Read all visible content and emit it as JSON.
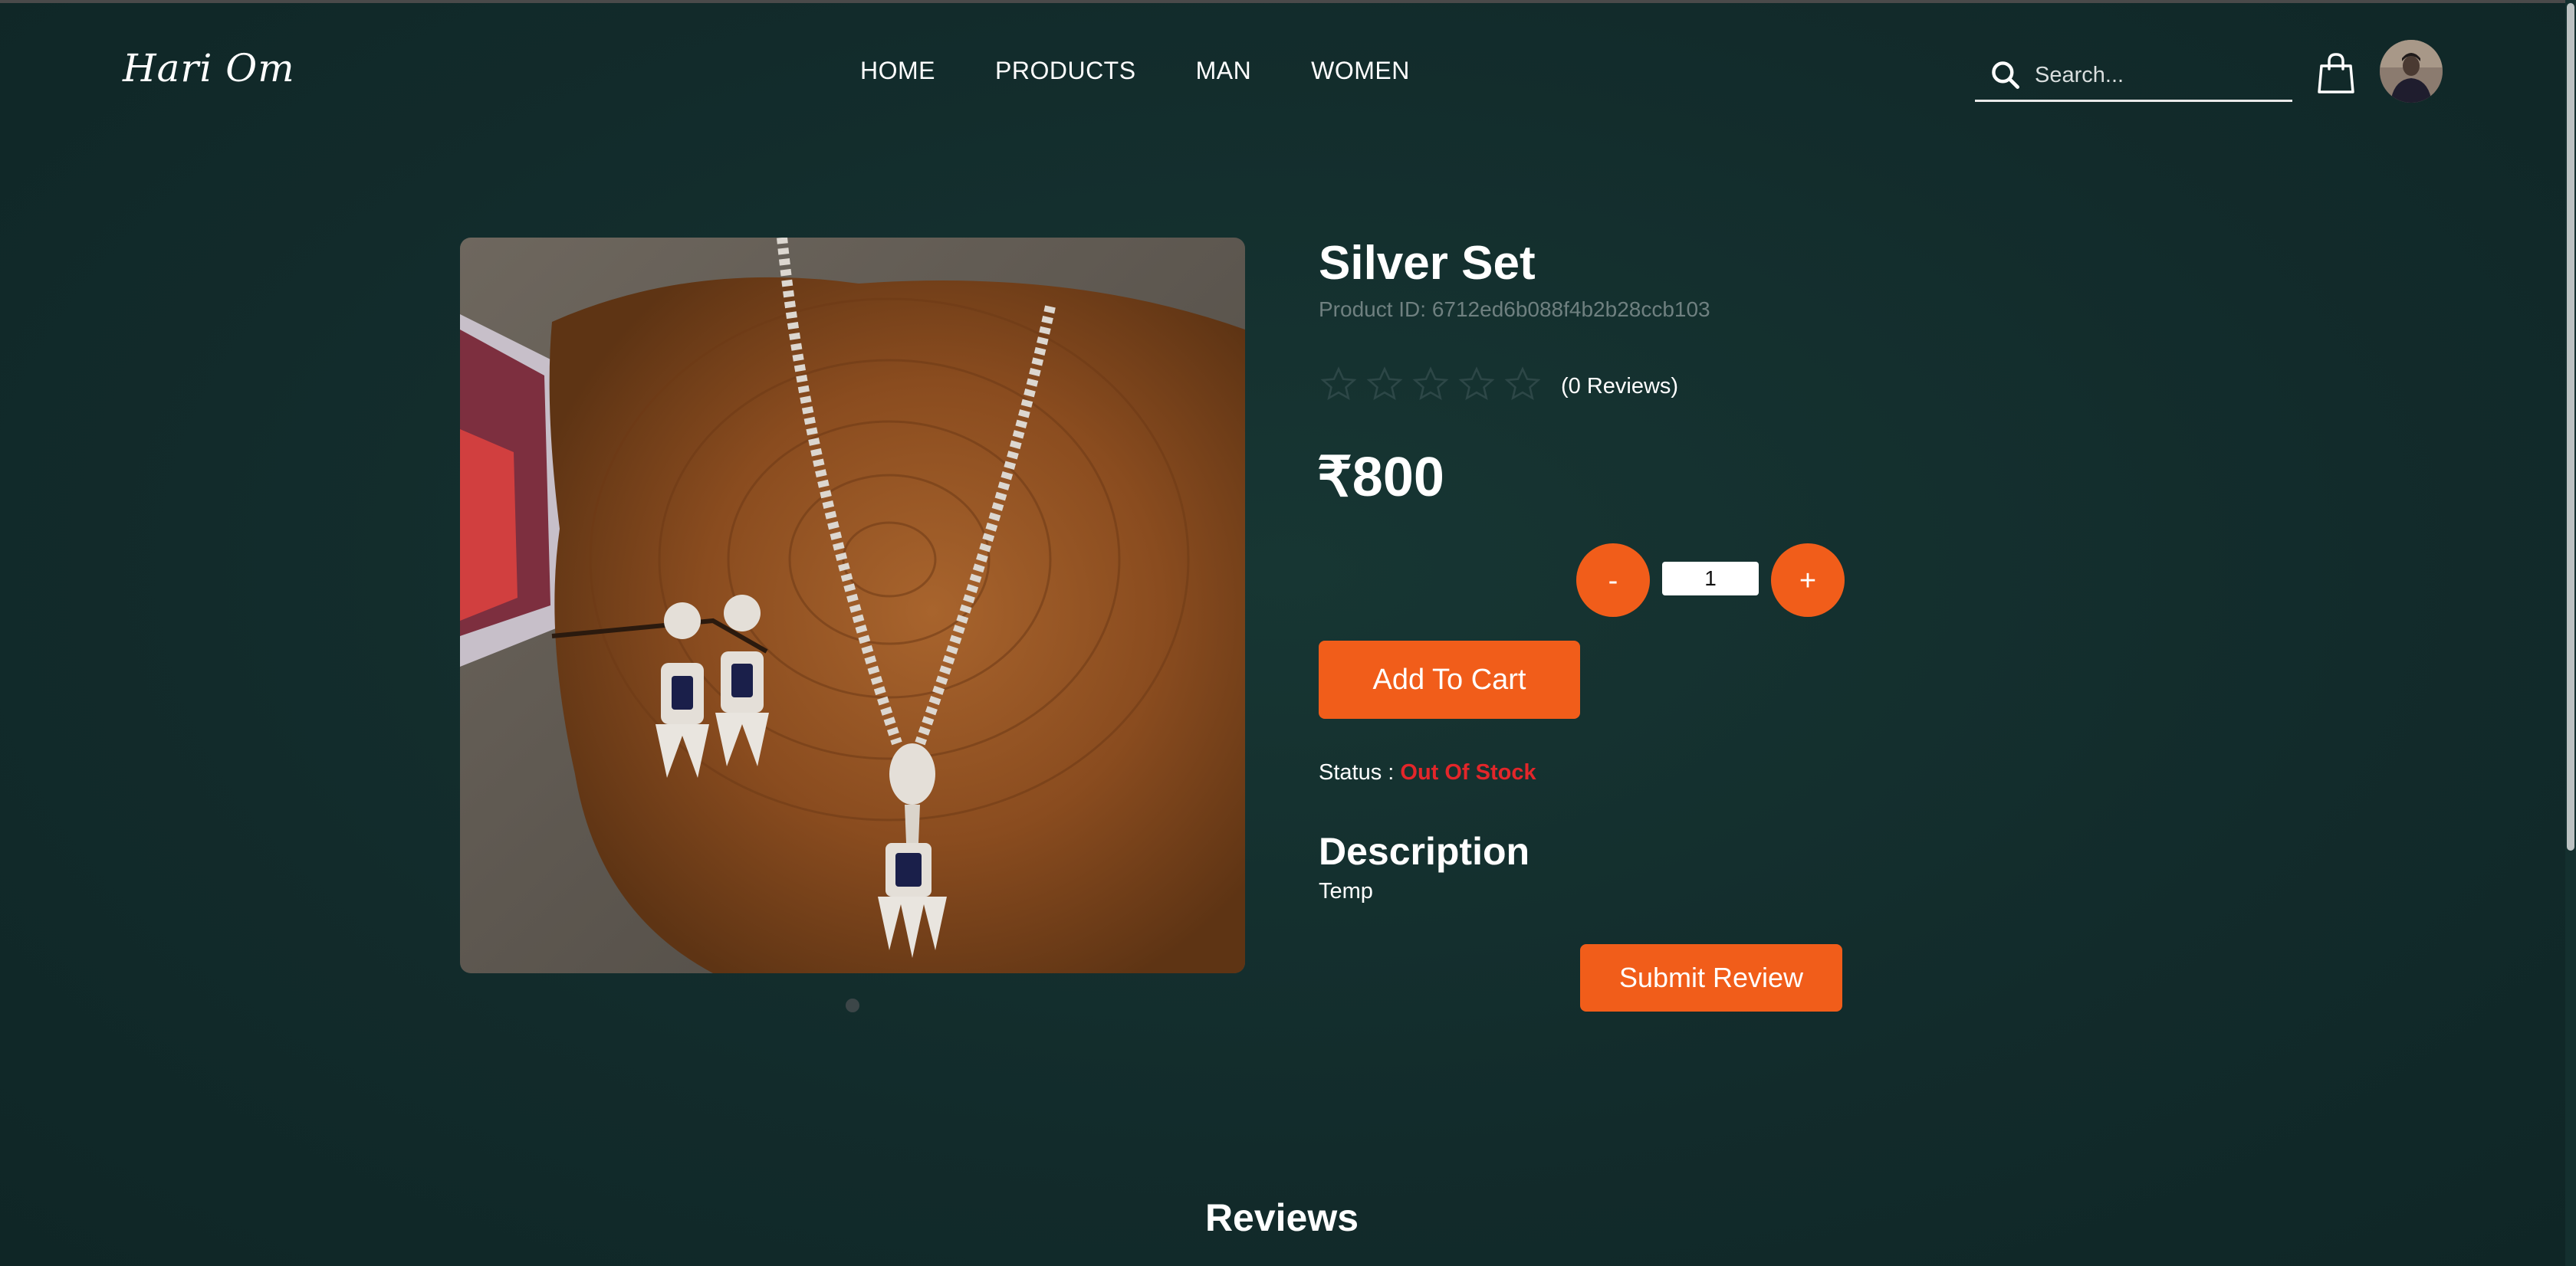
{
  "brand": {
    "logo_text": "Hari Om"
  },
  "nav": {
    "items": [
      {
        "label": "HOME"
      },
      {
        "label": "PRODUCTS"
      },
      {
        "label": "MAN"
      },
      {
        "label": "WOMEN"
      }
    ]
  },
  "search": {
    "placeholder": "Search...",
    "value": "",
    "icon": "search-icon"
  },
  "header_icons": {
    "cart": "shopping-bag-icon",
    "profile": "user-avatar"
  },
  "product": {
    "name": "Silver Set",
    "product_id": "Product ID: 6712ed6b088f4b2b28ccb103",
    "rating": 0,
    "rating_max": 5,
    "reviews_count_label": "(0 Reviews)",
    "price": "₹800",
    "quantity": "1",
    "minus_label": "-",
    "plus_label": "+",
    "add_to_cart_label": "Add To Cart",
    "status_label": "Status :",
    "status_value": "Out Of Stock",
    "description_title": "Description",
    "description_text": "Temp",
    "submit_review_label": "Submit Review"
  },
  "gallery": {
    "total_images": 1,
    "current_index": 0
  },
  "reviews_section": {
    "heading": "Reviews"
  },
  "colors": {
    "background": "#13302f",
    "accent": "#f15d1a",
    "status_out_of_stock": "#e3262a",
    "muted_text": "#6f8080"
  }
}
